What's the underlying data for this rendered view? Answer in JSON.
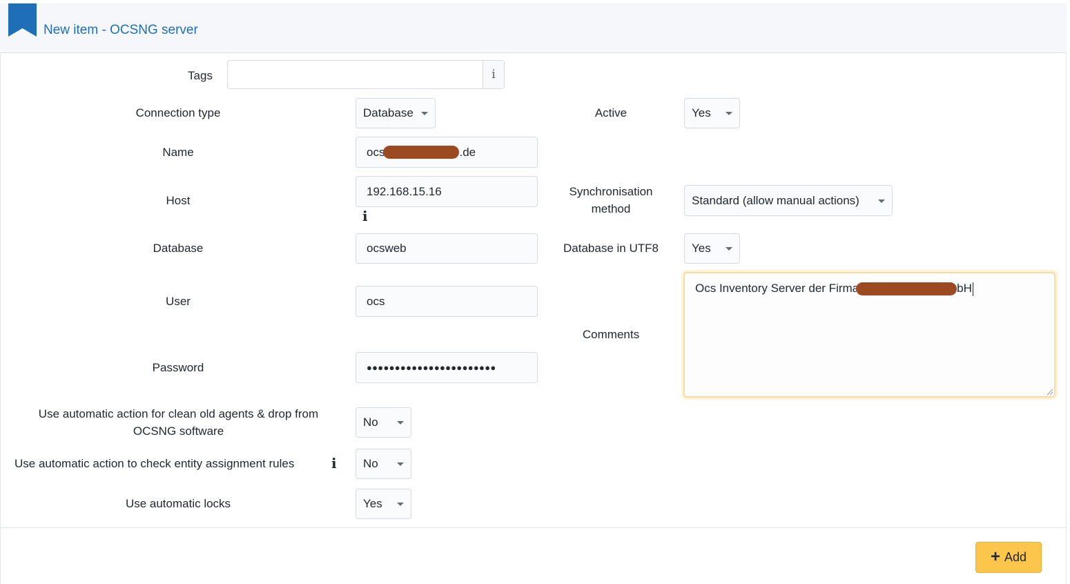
{
  "header": {
    "title": "New item - OCSNG server",
    "icon": "bookmark-icon"
  },
  "form": {
    "tags": {
      "label": "Tags",
      "value": "",
      "info_icon": "i"
    },
    "connection_type": {
      "label": "Connection type",
      "value": "Database"
    },
    "active": {
      "label": "Active",
      "value": "Yes"
    },
    "name": {
      "label": "Name",
      "value_prefix": "ocs",
      "value_suffix": ".de"
    },
    "host": {
      "label": "Host",
      "value": "192.168.15.16",
      "info_icon": "i"
    },
    "sync_method": {
      "label_line1": "Synchronisation",
      "label_line2": "method",
      "value": "Standard (allow manual actions)"
    },
    "database": {
      "label": "Database",
      "value": "ocsweb"
    },
    "db_utf8": {
      "label": "Database in UTF8",
      "value": "Yes"
    },
    "user": {
      "label": "User",
      "value": "ocs"
    },
    "comments": {
      "label": "Comments",
      "value_prefix": "Ocs Inventory Server der Firma",
      "value_suffix": "bH"
    },
    "password": {
      "label": "Password",
      "value": "●●●●●●●●●●●●●●●●●●●●●●●"
    },
    "clean_agents": {
      "label_line1": "Use automatic action for clean old agents & drop from",
      "label_line2": "OCSNG software",
      "value": "No"
    },
    "entity_rules": {
      "label": "Use automatic action to check entity assignment rules",
      "value": "No",
      "info_icon": "i"
    },
    "auto_locks": {
      "label": "Use automatic locks",
      "value": "Yes"
    }
  },
  "footer": {
    "add_button": "Add",
    "add_icon": "plus-icon"
  },
  "colors": {
    "title": "#1e6fb8",
    "bookmark": "#1e6fb8",
    "add_button": "#fbc64b",
    "header_bg": "#f5f7fb"
  }
}
